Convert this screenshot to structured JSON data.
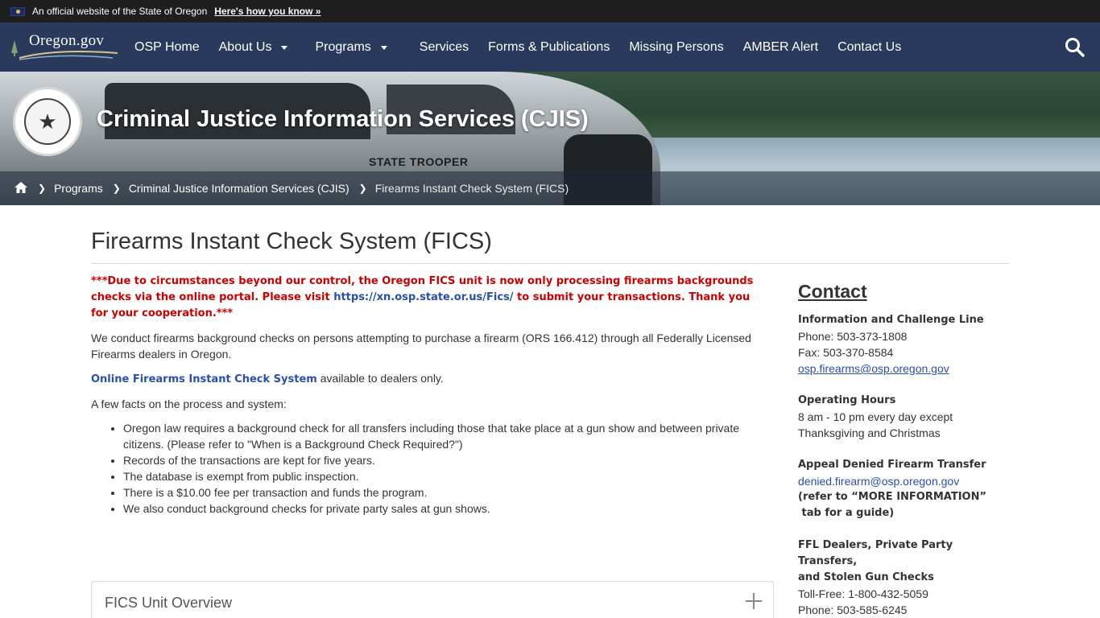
{
  "official_banner": {
    "text": "An official website of the State of Oregon",
    "link": "Here's how you know »"
  },
  "nav": {
    "logo_text": "Oregon.gov",
    "items": [
      {
        "label": "OSP Home",
        "dropdown": false
      },
      {
        "label": "About Us",
        "dropdown": true
      },
      {
        "label": "Programs",
        "dropdown": true
      },
      {
        "label": "Services",
        "dropdown": false
      },
      {
        "label": "Forms & Publications",
        "dropdown": false
      },
      {
        "label": "Missing Persons",
        "dropdown": false
      },
      {
        "label": "AMBER Alert",
        "dropdown": false
      },
      {
        "label": "Contact Us",
        "dropdown": false
      }
    ],
    "search_icon": "search-icon"
  },
  "hero": {
    "title": "Criminal Justice Information Services (CJIS)",
    "vehicle_text": "STATE TROOPER",
    "breadcrumb": [
      "Programs",
      "Criminal Justice Information Services (CJIS)",
      "Firearms Instant Check System (FICS)"
    ]
  },
  "page": {
    "title": "Firearms Instant Check System (FICS)",
    "notice_pre": "***Due to circumstances beyond our control, the Oregon FICS unit is now only processing firearms backgrounds checks via the online portal.  Please visit ",
    "notice_link": "https://xn.osp.state.or.us/Fics/",
    "notice_post": " to submit your transactions.  Thank you for your cooperation.***",
    "intro": "We conduct firearms background checks on persons attempting to purchase a firearm (ORS 166.412) through all Federally Licensed Firearms dealers in Oregon.",
    "online_link": "Online Firearms Instant Check System",
    "online_suffix": " available to dealers only.",
    "facts_lead": "A few facts on the process and system:",
    "facts": [
      "Oregon law requires a background check for all transfers including those that take place at a gun show and between private citizens. (Please refer to \"When is a Background Check Required?\")",
      "Records of the transactions are kept for five years.",
      "The database is exempt from public inspection.",
      "There is a $10.00 fee per transaction and funds the program.",
      "We also conduct background checks for private party sales at gun shows."
    ],
    "accordion_title": "FICS Unit Overview"
  },
  "sidebar": {
    "heading": "Contact",
    "info_head": "Information and Challenge Line",
    "info_phone": "Phone: 503-373-1808",
    "info_fax": "Fax: 503-370-8584",
    "info_email": "osp.firearms@osp.oregon.gov",
    "hours_head": "Operating Hours",
    "hours_line1": "8 am - 10 pm every day except",
    "hours_line2": "Thanksgiving and Christmas",
    "appeal_head": "Appeal Denied Firearm Transfer",
    "appeal_email": "denied.firearm@osp.oregon.gov",
    "appeal_note1": "(refer to “MORE INFORMATION”",
    "appeal_note2": " tab for a guide)",
    "ffl_head1": "FFL Dealers, Private Party Transfers,",
    "ffl_head2": "and Stolen Gun Checks",
    "ffl_tollfree": "Toll-Free: 1-800-432-5059",
    "ffl_phone": "Phone: 503-585-6245"
  },
  "colors": {
    "nav_bg": "#2a3a5c",
    "banner_bg": "#1f1f1f",
    "notice_red": "#cc0000",
    "link_blue": "#2a4db0"
  }
}
